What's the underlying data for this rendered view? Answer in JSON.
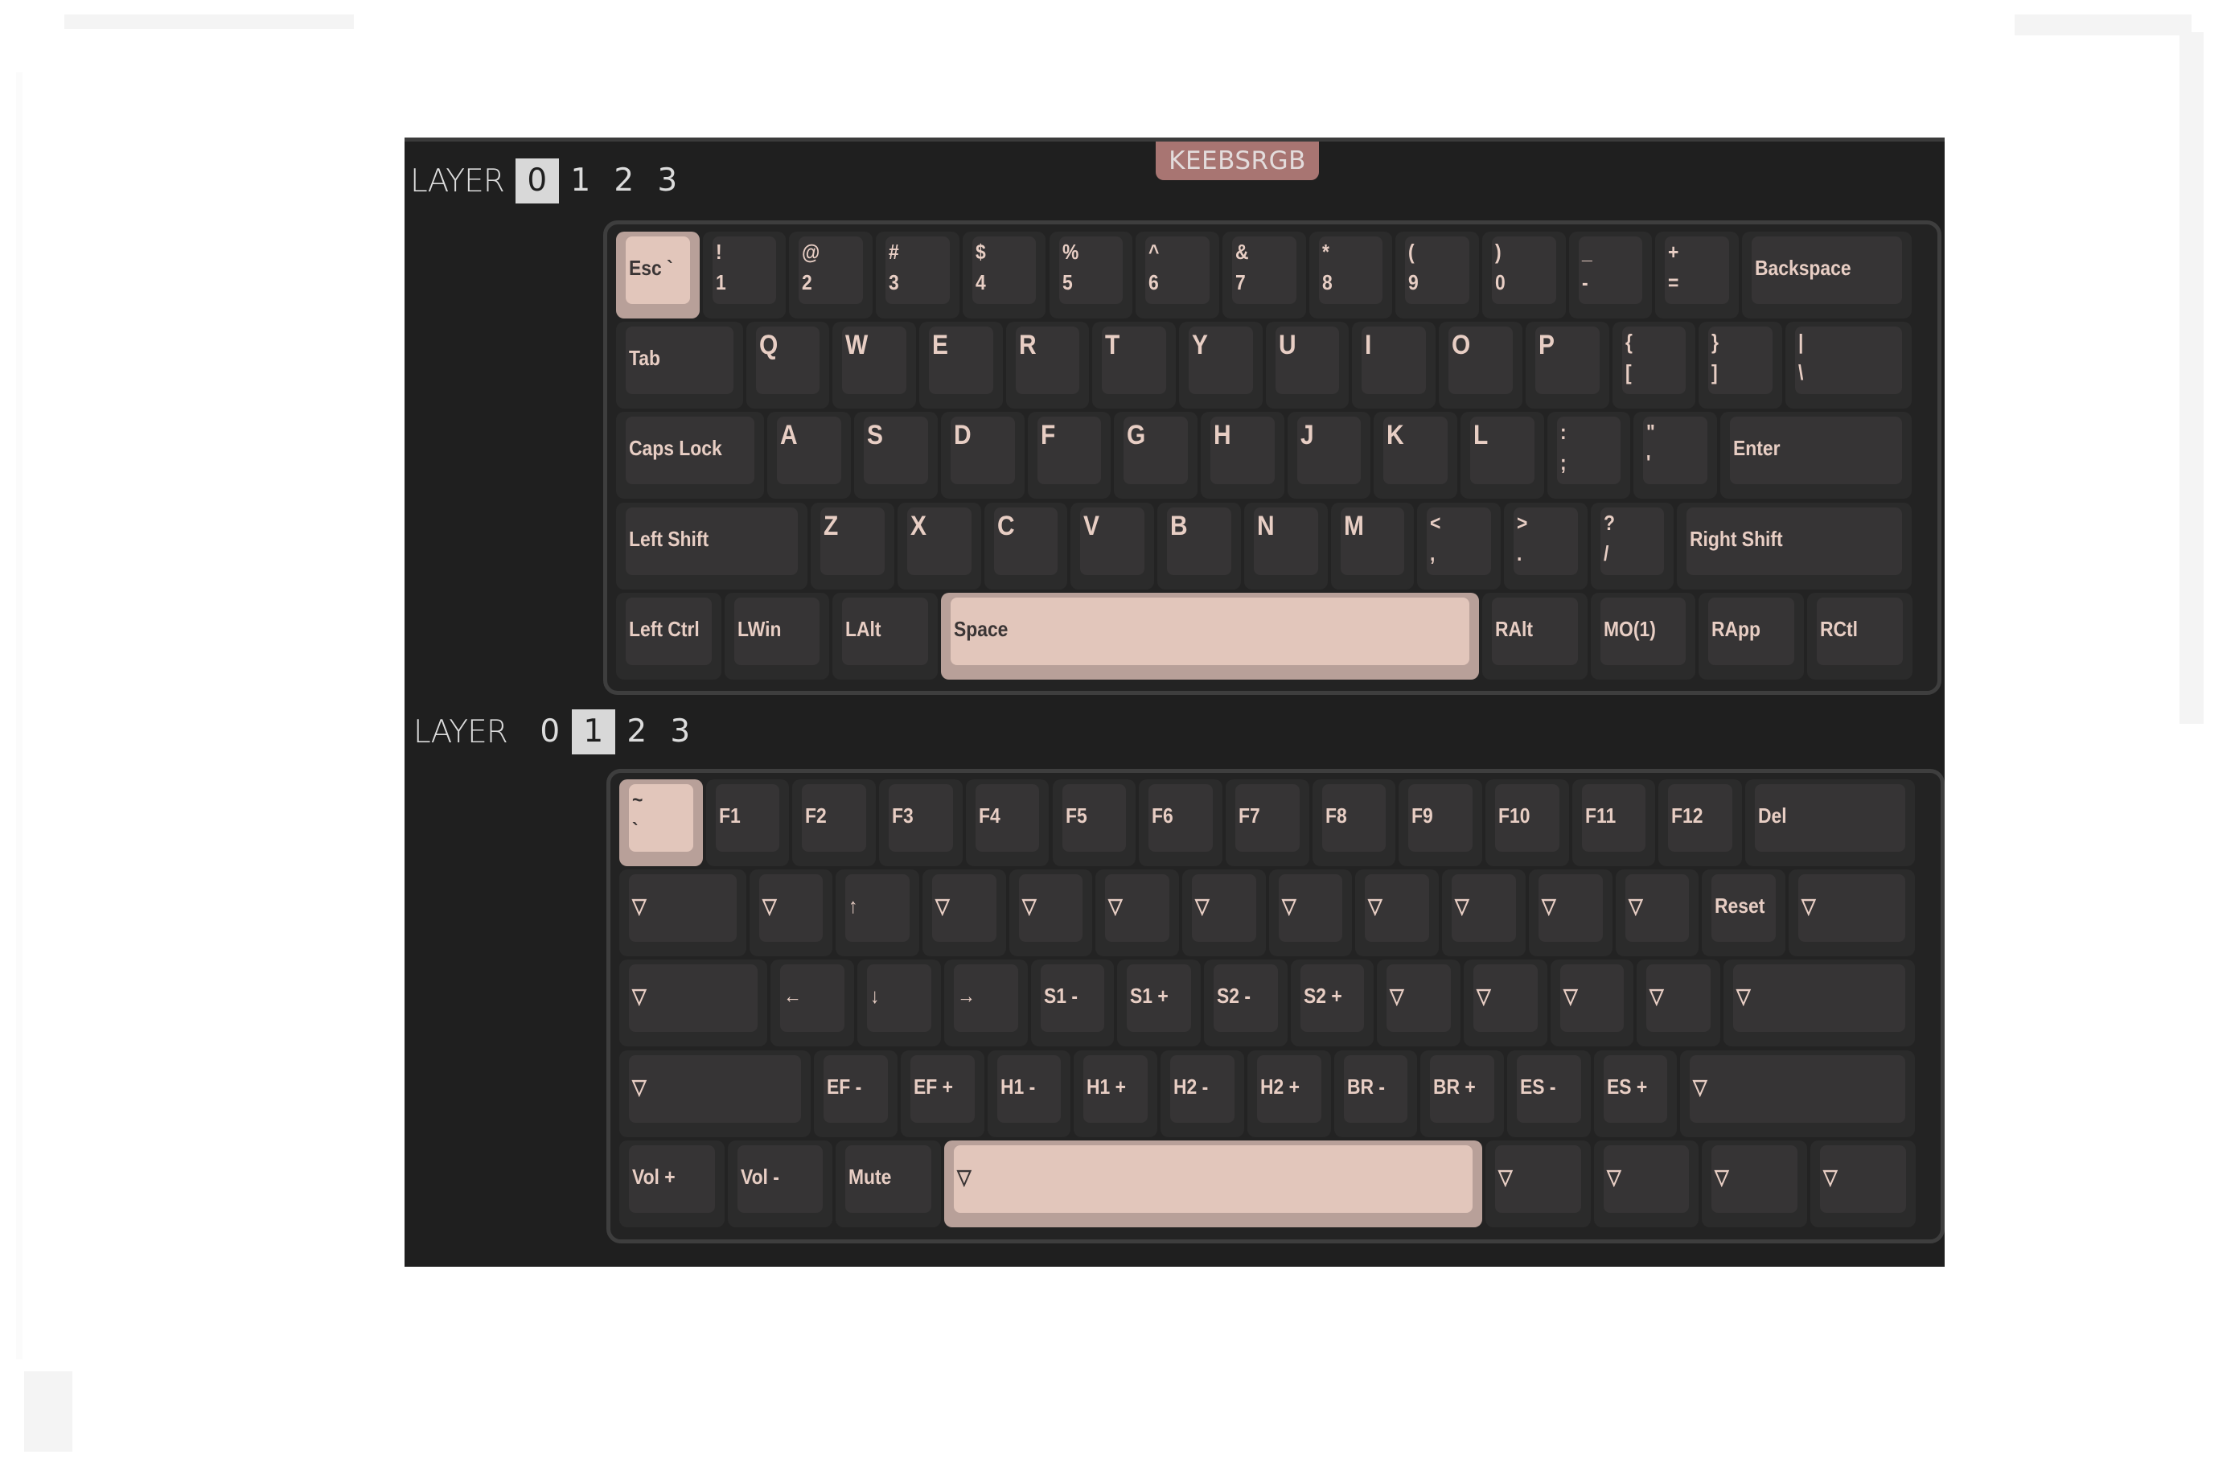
{
  "brand": "KEEBSRGB",
  "colors": {
    "panel_bg": "#1f1f1f",
    "brand_bg": "#a87572",
    "key_dark": "#363435",
    "key_accent": "#e2c6bb",
    "legend_light": "#e8cec4",
    "legend_dark": "#3a3535"
  },
  "layer_label": "LAYER",
  "layer_numbers": [
    "0",
    "1",
    "2",
    "3"
  ],
  "layers": [
    {
      "active_tab": 0,
      "rows": [
        [
          {
            "w": 1,
            "l": [
              "Esc `"
            ],
            "accent": true
          },
          {
            "w": 1,
            "l": [
              "!",
              "1"
            ]
          },
          {
            "w": 1,
            "l": [
              "@",
              "2"
            ]
          },
          {
            "w": 1,
            "l": [
              "#",
              "3"
            ]
          },
          {
            "w": 1,
            "l": [
              "$",
              "4"
            ]
          },
          {
            "w": 1,
            "l": [
              "%",
              "5"
            ]
          },
          {
            "w": 1,
            "l": [
              "^",
              "6"
            ]
          },
          {
            "w": 1,
            "l": [
              "&",
              "7"
            ]
          },
          {
            "w": 1,
            "l": [
              "*",
              "8"
            ]
          },
          {
            "w": 1,
            "l": [
              "(",
              "9"
            ]
          },
          {
            "w": 1,
            "l": [
              ")",
              "0"
            ]
          },
          {
            "w": 1,
            "l": [
              "_",
              "-"
            ]
          },
          {
            "w": 1,
            "l": [
              "+",
              "="
            ]
          },
          {
            "w": 2,
            "l": [
              "Backspace"
            ]
          }
        ],
        [
          {
            "w": 1.5,
            "l": [
              "Tab"
            ]
          },
          {
            "w": 1,
            "l": [
              "Q"
            ],
            "big": true
          },
          {
            "w": 1,
            "l": [
              "W"
            ],
            "big": true
          },
          {
            "w": 1,
            "l": [
              "E"
            ],
            "big": true
          },
          {
            "w": 1,
            "l": [
              "R"
            ],
            "big": true
          },
          {
            "w": 1,
            "l": [
              "T"
            ],
            "big": true
          },
          {
            "w": 1,
            "l": [
              "Y"
            ],
            "big": true
          },
          {
            "w": 1,
            "l": [
              "U"
            ],
            "big": true
          },
          {
            "w": 1,
            "l": [
              "I"
            ],
            "big": true
          },
          {
            "w": 1,
            "l": [
              "O"
            ],
            "big": true
          },
          {
            "w": 1,
            "l": [
              "P"
            ],
            "big": true
          },
          {
            "w": 1,
            "l": [
              "{",
              "["
            ]
          },
          {
            "w": 1,
            "l": [
              "}",
              "]"
            ]
          },
          {
            "w": 1.5,
            "l": [
              "|",
              "\\"
            ]
          }
        ],
        [
          {
            "w": 1.75,
            "l": [
              "Caps Lock"
            ]
          },
          {
            "w": 1,
            "l": [
              "A"
            ],
            "big": true
          },
          {
            "w": 1,
            "l": [
              "S"
            ],
            "big": true
          },
          {
            "w": 1,
            "l": [
              "D"
            ],
            "big": true
          },
          {
            "w": 1,
            "l": [
              "F"
            ],
            "big": true
          },
          {
            "w": 1,
            "l": [
              "G"
            ],
            "big": true
          },
          {
            "w": 1,
            "l": [
              "H"
            ],
            "big": true
          },
          {
            "w": 1,
            "l": [
              "J"
            ],
            "big": true
          },
          {
            "w": 1,
            "l": [
              "K"
            ],
            "big": true
          },
          {
            "w": 1,
            "l": [
              "L"
            ],
            "big": true
          },
          {
            "w": 1,
            "l": [
              ":",
              ";"
            ]
          },
          {
            "w": 1,
            "l": [
              "\"",
              "'"
            ]
          },
          {
            "w": 2.25,
            "l": [
              "Enter"
            ]
          }
        ],
        [
          {
            "w": 2.25,
            "l": [
              "Left Shift"
            ]
          },
          {
            "w": 1,
            "l": [
              "Z"
            ],
            "big": true
          },
          {
            "w": 1,
            "l": [
              "X"
            ],
            "big": true
          },
          {
            "w": 1,
            "l": [
              "C"
            ],
            "big": true
          },
          {
            "w": 1,
            "l": [
              "V"
            ],
            "big": true
          },
          {
            "w": 1,
            "l": [
              "B"
            ],
            "big": true
          },
          {
            "w": 1,
            "l": [
              "N"
            ],
            "big": true
          },
          {
            "w": 1,
            "l": [
              "M"
            ],
            "big": true
          },
          {
            "w": 1,
            "l": [
              "<",
              ","
            ]
          },
          {
            "w": 1,
            "l": [
              ">",
              "."
            ]
          },
          {
            "w": 1,
            "l": [
              "?",
              "/"
            ]
          },
          {
            "w": 2.75,
            "l": [
              "Right Shift"
            ]
          }
        ],
        [
          {
            "w": 1.25,
            "l": [
              "Left Ctrl"
            ]
          },
          {
            "w": 1.25,
            "l": [
              "LWin"
            ]
          },
          {
            "w": 1.25,
            "l": [
              "LAlt"
            ]
          },
          {
            "w": 6.25,
            "l": [
              "Space"
            ],
            "accent": true
          },
          {
            "w": 1.25,
            "l": [
              "RAlt"
            ]
          },
          {
            "w": 1.25,
            "l": [
              "MO(1)"
            ]
          },
          {
            "w": 1.25,
            "l": [
              "RApp"
            ]
          },
          {
            "w": 1.25,
            "l": [
              "RCtl"
            ]
          }
        ]
      ]
    },
    {
      "active_tab": 1,
      "rows": [
        [
          {
            "w": 1,
            "l": [
              "~",
              "`"
            ],
            "accent": true
          },
          {
            "w": 1,
            "l": [
              "F1"
            ]
          },
          {
            "w": 1,
            "l": [
              "F2"
            ]
          },
          {
            "w": 1,
            "l": [
              "F3"
            ]
          },
          {
            "w": 1,
            "l": [
              "F4"
            ]
          },
          {
            "w": 1,
            "l": [
              "F5"
            ]
          },
          {
            "w": 1,
            "l": [
              "F6"
            ]
          },
          {
            "w": 1,
            "l": [
              "F7"
            ]
          },
          {
            "w": 1,
            "l": [
              "F8"
            ]
          },
          {
            "w": 1,
            "l": [
              "F9"
            ]
          },
          {
            "w": 1,
            "l": [
              "F10"
            ]
          },
          {
            "w": 1,
            "l": [
              "F11"
            ]
          },
          {
            "w": 1,
            "l": [
              "F12"
            ]
          },
          {
            "w": 2,
            "l": [
              "Del"
            ]
          }
        ],
        [
          {
            "w": 1.5,
            "l": [
              "▽"
            ]
          },
          {
            "w": 1,
            "l": [
              "▽"
            ]
          },
          {
            "w": 1,
            "l": [
              "↑"
            ]
          },
          {
            "w": 1,
            "l": [
              "▽"
            ]
          },
          {
            "w": 1,
            "l": [
              "▽"
            ]
          },
          {
            "w": 1,
            "l": [
              "▽"
            ]
          },
          {
            "w": 1,
            "l": [
              "▽"
            ]
          },
          {
            "w": 1,
            "l": [
              "▽"
            ]
          },
          {
            "w": 1,
            "l": [
              "▽"
            ]
          },
          {
            "w": 1,
            "l": [
              "▽"
            ]
          },
          {
            "w": 1,
            "l": [
              "▽"
            ]
          },
          {
            "w": 1,
            "l": [
              "▽"
            ]
          },
          {
            "w": 1,
            "l": [
              "Reset"
            ]
          },
          {
            "w": 1.5,
            "l": [
              "▽"
            ]
          }
        ],
        [
          {
            "w": 1.75,
            "l": [
              "▽"
            ]
          },
          {
            "w": 1,
            "l": [
              "←"
            ]
          },
          {
            "w": 1,
            "l": [
              "↓"
            ]
          },
          {
            "w": 1,
            "l": [
              "→"
            ]
          },
          {
            "w": 1,
            "l": [
              "S1 -"
            ]
          },
          {
            "w": 1,
            "l": [
              "S1 +"
            ]
          },
          {
            "w": 1,
            "l": [
              "S2 -"
            ]
          },
          {
            "w": 1,
            "l": [
              "S2 +"
            ]
          },
          {
            "w": 1,
            "l": [
              "▽"
            ]
          },
          {
            "w": 1,
            "l": [
              "▽"
            ]
          },
          {
            "w": 1,
            "l": [
              "▽"
            ]
          },
          {
            "w": 1,
            "l": [
              "▽"
            ]
          },
          {
            "w": 2.25,
            "l": [
              "▽"
            ]
          }
        ],
        [
          {
            "w": 2.25,
            "l": [
              "▽"
            ]
          },
          {
            "w": 1,
            "l": [
              "EF -"
            ]
          },
          {
            "w": 1,
            "l": [
              "EF +"
            ]
          },
          {
            "w": 1,
            "l": [
              "H1 -"
            ]
          },
          {
            "w": 1,
            "l": [
              "H1 +"
            ]
          },
          {
            "w": 1,
            "l": [
              "H2 -"
            ]
          },
          {
            "w": 1,
            "l": [
              "H2 +"
            ]
          },
          {
            "w": 1,
            "l": [
              "BR -"
            ]
          },
          {
            "w": 1,
            "l": [
              "BR +"
            ]
          },
          {
            "w": 1,
            "l": [
              "ES -"
            ]
          },
          {
            "w": 1,
            "l": [
              "ES +"
            ]
          },
          {
            "w": 2.75,
            "l": [
              "▽"
            ]
          }
        ],
        [
          {
            "w": 1.25,
            "l": [
              "Vol +"
            ]
          },
          {
            "w": 1.25,
            "l": [
              "Vol -"
            ]
          },
          {
            "w": 1.25,
            "l": [
              "Mute"
            ]
          },
          {
            "w": 6.25,
            "l": [
              "▽"
            ],
            "accent": true
          },
          {
            "w": 1.25,
            "l": [
              "▽"
            ]
          },
          {
            "w": 1.25,
            "l": [
              "▽"
            ]
          },
          {
            "w": 1.25,
            "l": [
              "▽"
            ]
          },
          {
            "w": 1.25,
            "l": [
              "▽"
            ]
          }
        ]
      ]
    }
  ]
}
